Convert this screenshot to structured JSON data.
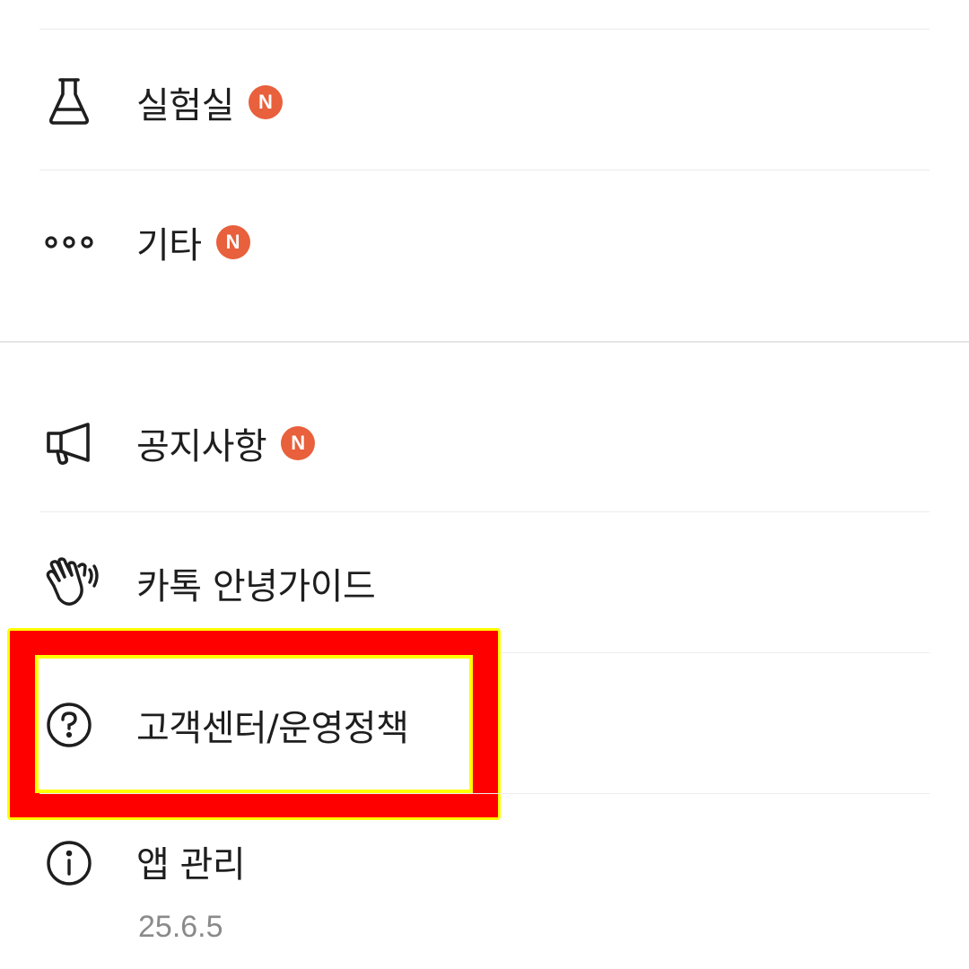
{
  "menu_top": [
    {
      "label": "실험실",
      "badge": "N",
      "icon": "flask-icon"
    },
    {
      "label": "기타",
      "badge": "N",
      "icon": "more-dots-icon"
    }
  ],
  "menu_bottom": [
    {
      "label": "공지사항",
      "badge": "N",
      "icon": "megaphone-icon"
    },
    {
      "label": "카톡 안녕가이드",
      "icon": "waving-hand-icon"
    },
    {
      "label": "고객센터/운영정책",
      "icon": "question-circle-icon"
    },
    {
      "label": "앱 관리",
      "icon": "info-circle-icon",
      "sub": "25.6.5"
    }
  ],
  "colors": {
    "badge": "#e8603c",
    "highlight_fill": "#ff0000",
    "highlight_border": "#ffff00",
    "text": "#1e1e1e",
    "subtext": "#8a8a8a"
  }
}
